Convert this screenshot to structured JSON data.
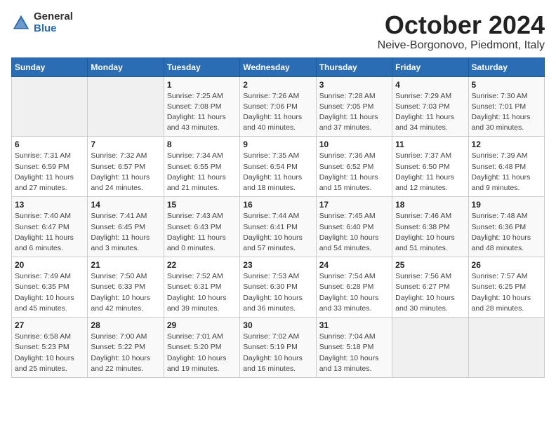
{
  "logo": {
    "general": "General",
    "blue": "Blue"
  },
  "title": "October 2024",
  "location": "Neive-Borgonovo, Piedmont, Italy",
  "headers": [
    "Sunday",
    "Monday",
    "Tuesday",
    "Wednesday",
    "Thursday",
    "Friday",
    "Saturday"
  ],
  "weeks": [
    [
      {
        "day": "",
        "info": ""
      },
      {
        "day": "",
        "info": ""
      },
      {
        "day": "1",
        "info": "Sunrise: 7:25 AM\nSunset: 7:08 PM\nDaylight: 11 hours and 43 minutes."
      },
      {
        "day": "2",
        "info": "Sunrise: 7:26 AM\nSunset: 7:06 PM\nDaylight: 11 hours and 40 minutes."
      },
      {
        "day": "3",
        "info": "Sunrise: 7:28 AM\nSunset: 7:05 PM\nDaylight: 11 hours and 37 minutes."
      },
      {
        "day": "4",
        "info": "Sunrise: 7:29 AM\nSunset: 7:03 PM\nDaylight: 11 hours and 34 minutes."
      },
      {
        "day": "5",
        "info": "Sunrise: 7:30 AM\nSunset: 7:01 PM\nDaylight: 11 hours and 30 minutes."
      }
    ],
    [
      {
        "day": "6",
        "info": "Sunrise: 7:31 AM\nSunset: 6:59 PM\nDaylight: 11 hours and 27 minutes."
      },
      {
        "day": "7",
        "info": "Sunrise: 7:32 AM\nSunset: 6:57 PM\nDaylight: 11 hours and 24 minutes."
      },
      {
        "day": "8",
        "info": "Sunrise: 7:34 AM\nSunset: 6:55 PM\nDaylight: 11 hours and 21 minutes."
      },
      {
        "day": "9",
        "info": "Sunrise: 7:35 AM\nSunset: 6:54 PM\nDaylight: 11 hours and 18 minutes."
      },
      {
        "day": "10",
        "info": "Sunrise: 7:36 AM\nSunset: 6:52 PM\nDaylight: 11 hours and 15 minutes."
      },
      {
        "day": "11",
        "info": "Sunrise: 7:37 AM\nSunset: 6:50 PM\nDaylight: 11 hours and 12 minutes."
      },
      {
        "day": "12",
        "info": "Sunrise: 7:39 AM\nSunset: 6:48 PM\nDaylight: 11 hours and 9 minutes."
      }
    ],
    [
      {
        "day": "13",
        "info": "Sunrise: 7:40 AM\nSunset: 6:47 PM\nDaylight: 11 hours and 6 minutes."
      },
      {
        "day": "14",
        "info": "Sunrise: 7:41 AM\nSunset: 6:45 PM\nDaylight: 11 hours and 3 minutes."
      },
      {
        "day": "15",
        "info": "Sunrise: 7:43 AM\nSunset: 6:43 PM\nDaylight: 11 hours and 0 minutes."
      },
      {
        "day": "16",
        "info": "Sunrise: 7:44 AM\nSunset: 6:41 PM\nDaylight: 10 hours and 57 minutes."
      },
      {
        "day": "17",
        "info": "Sunrise: 7:45 AM\nSunset: 6:40 PM\nDaylight: 10 hours and 54 minutes."
      },
      {
        "day": "18",
        "info": "Sunrise: 7:46 AM\nSunset: 6:38 PM\nDaylight: 10 hours and 51 minutes."
      },
      {
        "day": "19",
        "info": "Sunrise: 7:48 AM\nSunset: 6:36 PM\nDaylight: 10 hours and 48 minutes."
      }
    ],
    [
      {
        "day": "20",
        "info": "Sunrise: 7:49 AM\nSunset: 6:35 PM\nDaylight: 10 hours and 45 minutes."
      },
      {
        "day": "21",
        "info": "Sunrise: 7:50 AM\nSunset: 6:33 PM\nDaylight: 10 hours and 42 minutes."
      },
      {
        "day": "22",
        "info": "Sunrise: 7:52 AM\nSunset: 6:31 PM\nDaylight: 10 hours and 39 minutes."
      },
      {
        "day": "23",
        "info": "Sunrise: 7:53 AM\nSunset: 6:30 PM\nDaylight: 10 hours and 36 minutes."
      },
      {
        "day": "24",
        "info": "Sunrise: 7:54 AM\nSunset: 6:28 PM\nDaylight: 10 hours and 33 minutes."
      },
      {
        "day": "25",
        "info": "Sunrise: 7:56 AM\nSunset: 6:27 PM\nDaylight: 10 hours and 30 minutes."
      },
      {
        "day": "26",
        "info": "Sunrise: 7:57 AM\nSunset: 6:25 PM\nDaylight: 10 hours and 28 minutes."
      }
    ],
    [
      {
        "day": "27",
        "info": "Sunrise: 6:58 AM\nSunset: 5:23 PM\nDaylight: 10 hours and 25 minutes."
      },
      {
        "day": "28",
        "info": "Sunrise: 7:00 AM\nSunset: 5:22 PM\nDaylight: 10 hours and 22 minutes."
      },
      {
        "day": "29",
        "info": "Sunrise: 7:01 AM\nSunset: 5:20 PM\nDaylight: 10 hours and 19 minutes."
      },
      {
        "day": "30",
        "info": "Sunrise: 7:02 AM\nSunset: 5:19 PM\nDaylight: 10 hours and 16 minutes."
      },
      {
        "day": "31",
        "info": "Sunrise: 7:04 AM\nSunset: 5:18 PM\nDaylight: 10 hours and 13 minutes."
      },
      {
        "day": "",
        "info": ""
      },
      {
        "day": "",
        "info": ""
      }
    ]
  ]
}
